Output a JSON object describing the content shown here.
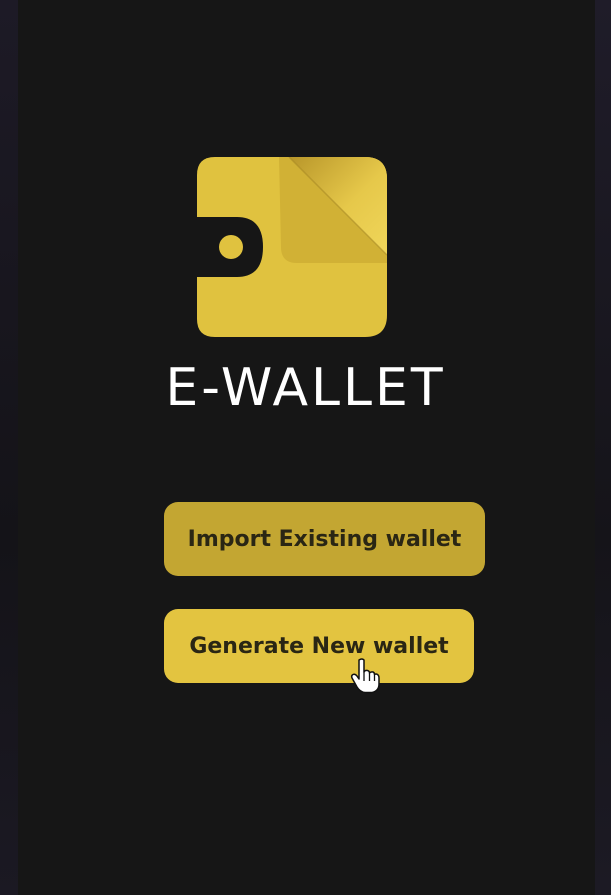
{
  "app": {
    "title": "E-WALLET"
  },
  "logo": {
    "icon": "wallet-icon",
    "color": "#e0c23f"
  },
  "actions": {
    "import_label": "Import Existing wallet",
    "generate_label": "Generate New wallet"
  },
  "pointer": {
    "icon": "hand-pointer-icon"
  },
  "colors": {
    "background": "#161616",
    "accent": "#e3c440",
    "accent_muted": "#c3a632",
    "button_text": "#2a2614",
    "title_text": "#ffffff"
  }
}
